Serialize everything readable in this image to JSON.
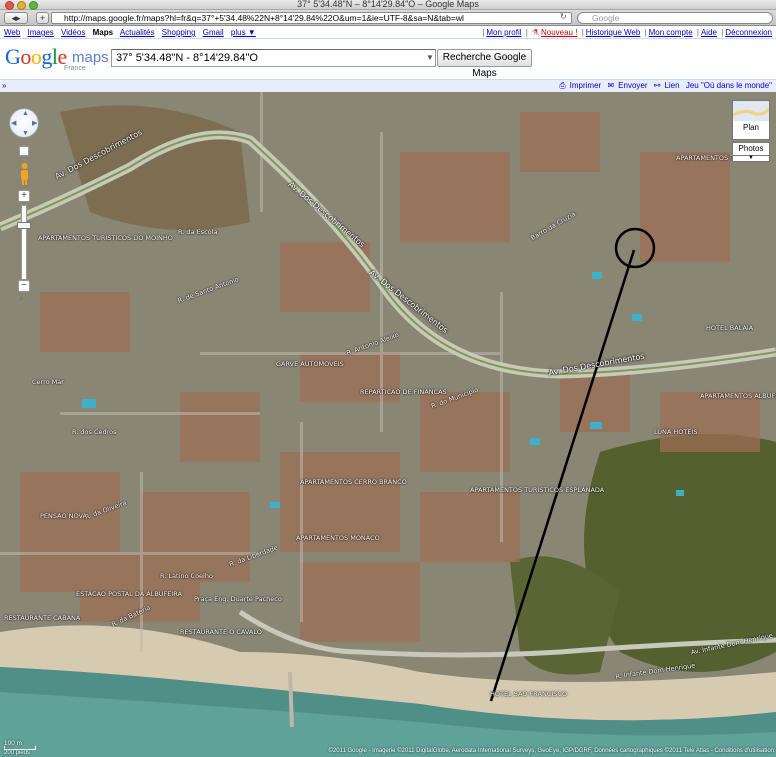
{
  "window": {
    "title": "37° 5'34.48\"N – 8°14'29.84\"O – Google Maps"
  },
  "browser": {
    "url": "http://maps.google.fr/maps?hl=fr&q=37°+5'34.48%22N+8°14'29.84%22O&um=1&ie=UTF-8&sa=N&tab=wl",
    "search_placeholder": "Google",
    "back_icon": "back-arrow-icon",
    "forward_icon": "forward-arrow-icon",
    "add_icon": "plus-icon",
    "reload_icon": "reload-icon"
  },
  "gbar": {
    "left": [
      "Web",
      "Images",
      "Vidéos",
      "Maps",
      "Actualités",
      "Shopping",
      "Gmail",
      "plus ▼"
    ],
    "current": "Maps",
    "right": [
      "Mon profil",
      "Nouveau !",
      "Historique Web",
      "Mon compte",
      "Aide",
      "Déconnexion"
    ]
  },
  "header": {
    "logo_letters": [
      "G",
      "o",
      "o",
      "g",
      "l",
      "e"
    ],
    "logo_maps": "maps",
    "logo_sub": "France",
    "query": "37° 5'34.48\"N - 8°14'29.84\"O",
    "search_button": "Recherche Google Maps"
  },
  "links_bar": {
    "collapse": "»",
    "items": [
      "Imprimer",
      "Envoyer",
      "Lien",
      "Jeu \"Où dans le monde\""
    ]
  },
  "map": {
    "view_plan": "Plan",
    "view_photos": "Photos",
    "view_photos_arrow": "▼",
    "zoom_in": "+",
    "zoom_out": "−",
    "scale_m": "100 m",
    "scale_ft": "200 pieds",
    "copyright": "©2011 Google - Imagerie ©2011 DigitalGlobe, Aerodata International Surveys, GeoEye, IGP/DGRF, Données cartographiques ©2011 Tele Atlas - Conditions d'utilisation",
    "road_labels": [
      "Av. Dos Descobrimentos",
      "Av. Dos Descobrimentos",
      "Av. Dos Descobrimentos",
      "Av. Dos Descobrimentos"
    ],
    "place_labels": [
      "APARTAMENTOS TURISTICOS DO MOINHO",
      "R. da Escola",
      "R. de Santo Antonio",
      "R. Antonio Aleixo",
      "R. dos Cedros",
      "Cerro Mar",
      "GARVE AUTOMOVEIS",
      "REPARTICAO DE FINANCAS",
      "R. do Municipio",
      "Barro da Cruzia",
      "APARTAMENTOS TURISTICOS",
      "APARTAMENTOS CERRO BRANCO",
      "APARTAMENTOS MONACO",
      "R. da Oliveira",
      "APARTAMENTOS TURISTICOS ESPLANADA",
      "PENSAO NOVA",
      "RESTAURANTE CABANA",
      "RESTAURANTE O CAVALO",
      "R. Infante Dom Henrique",
      "Av. Infante Dom Henrique",
      "R. Latino Coelho",
      "ESTACAO POSTAL DA ALBUFEIRA",
      "Praça Eng. Duarte Pacheco",
      "HOTEL BALAIA",
      "LUNA HOTEIS",
      "APARTAMENTOS ALBUFEIRA",
      "HOTEL SAO FRANCISCO",
      "R. da Bateria",
      "R. da Liberdade"
    ]
  }
}
